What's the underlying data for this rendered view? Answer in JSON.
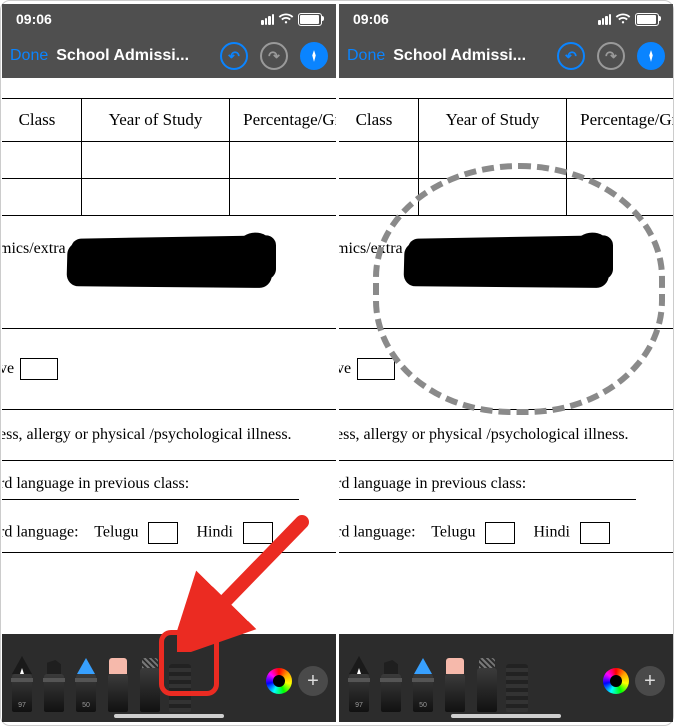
{
  "status": {
    "time": "09:06"
  },
  "nav": {
    "done": "Done",
    "title": "School Admissi..."
  },
  "table": {
    "headers": [
      "Class",
      "Year of Study",
      "Percentage/Gra"
    ]
  },
  "form": {
    "mics_label": "mics/extra",
    "ve_label": "ve",
    "illness_text": "ess, allergy or physical /psychological illness.",
    "prev_lang_label": "rd language in previous class:",
    "lang_label": "rd language:",
    "telugu": "Telugu",
    "hindi": "Hindi"
  },
  "tools": {
    "pen_size": "97",
    "pencil_size": "50"
  }
}
